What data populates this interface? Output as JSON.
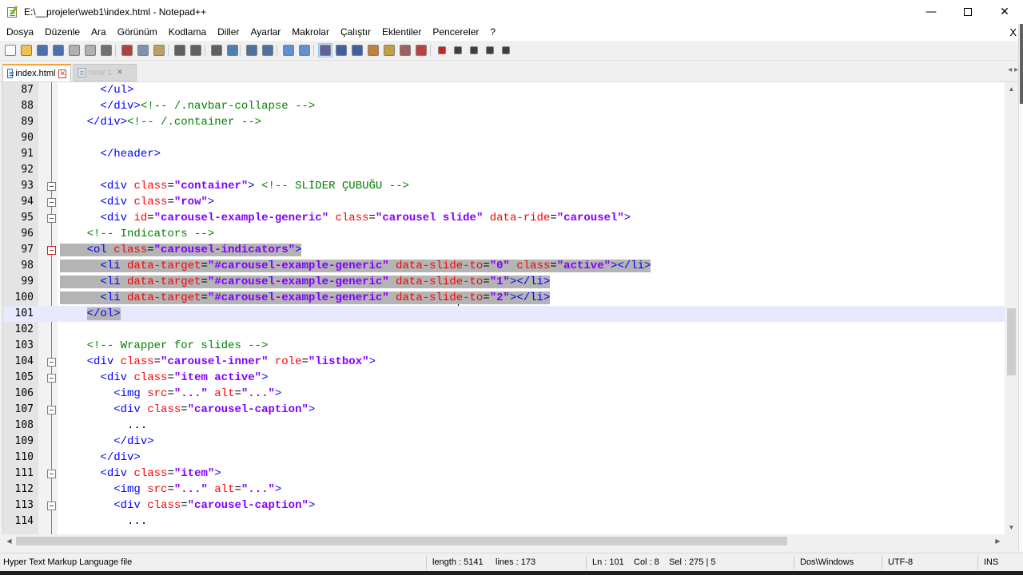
{
  "window": {
    "title": "E:\\__projeler\\web1\\index.html - Notepad++",
    "minimize": "—",
    "close": "✕"
  },
  "menu": {
    "items": [
      "Dosya",
      "Düzenle",
      "Ara",
      "Görünüm",
      "Kodlama",
      "Diller",
      "Ayarlar",
      "Makrolar",
      "Çalıştır",
      "Eklentiler",
      "Pencereler",
      "?"
    ],
    "close_doc": "X"
  },
  "tabs": [
    {
      "label": "index.html",
      "close": "✕"
    },
    {
      "label": "new 1",
      "close": "✕"
    }
  ],
  "tab_scroll": "◂ ▸",
  "editor": {
    "lines": [
      {
        "n": "87",
        "code": [
          [
            "      ",
            "pl"
          ],
          [
            "</ul>",
            "tag"
          ]
        ]
      },
      {
        "n": "88",
        "code": [
          [
            "      ",
            "pl"
          ],
          [
            "</div>",
            "tag"
          ],
          [
            "<!-- /.navbar-collapse -->",
            "cm"
          ]
        ]
      },
      {
        "n": "89",
        "code": [
          [
            "    ",
            "pl"
          ],
          [
            "</div>",
            "tag"
          ],
          [
            "<!-- /.container -->",
            "cm"
          ]
        ]
      },
      {
        "n": "90",
        "code": []
      },
      {
        "n": "91",
        "code": [
          [
            "      ",
            "pl"
          ],
          [
            "</header>",
            "tag"
          ]
        ]
      },
      {
        "n": "92",
        "code": []
      },
      {
        "n": "93",
        "code": [
          [
            "      ",
            "pl"
          ],
          [
            "<div ",
            "tag"
          ],
          [
            "class",
            "attr"
          ],
          [
            "=",
            "pl"
          ],
          [
            "\"container\"",
            "val"
          ],
          [
            "> ",
            "tag"
          ],
          [
            "<!-- SLİDER ÇUBUĞU -->",
            "cm"
          ]
        ]
      },
      {
        "n": "94",
        "code": [
          [
            "      ",
            "pl"
          ],
          [
            "<div ",
            "tag"
          ],
          [
            "class",
            "attr"
          ],
          [
            "=",
            "pl"
          ],
          [
            "\"row\"",
            "val"
          ],
          [
            ">",
            "tag"
          ]
        ]
      },
      {
        "n": "95",
        "code": [
          [
            "      ",
            "pl"
          ],
          [
            "<div ",
            "tag"
          ],
          [
            "id",
            "attr"
          ],
          [
            "=",
            "pl"
          ],
          [
            "\"carousel-example-generic\"",
            "val"
          ],
          [
            " ",
            "pl"
          ],
          [
            "class",
            "attr"
          ],
          [
            "=",
            "pl"
          ],
          [
            "\"carousel slide\"",
            "val"
          ],
          [
            " ",
            "pl"
          ],
          [
            "data-ride",
            "attr"
          ],
          [
            "=",
            "pl"
          ],
          [
            "\"carousel\"",
            "val"
          ],
          [
            ">",
            "tag"
          ]
        ]
      },
      {
        "n": "96",
        "code": [
          [
            "    ",
            "pl"
          ],
          [
            "<!-- Indicators -->",
            "cm"
          ]
        ]
      },
      {
        "n": "97",
        "code": [
          [
            "    ",
            "pl"
          ],
          [
            "<ol ",
            "tag"
          ],
          [
            "class",
            "attr"
          ],
          [
            "=",
            "pl"
          ],
          [
            "\"carousel-indicators\"",
            "val"
          ],
          [
            ">",
            "tag"
          ]
        ]
      },
      {
        "n": "98",
        "code": [
          [
            "      ",
            "pl"
          ],
          [
            "<li ",
            "tag"
          ],
          [
            "data-target",
            "attr"
          ],
          [
            "=",
            "pl"
          ],
          [
            "\"#carousel-example-generic\"",
            "val"
          ],
          [
            " ",
            "pl"
          ],
          [
            "data-slide-to",
            "attr"
          ],
          [
            "=",
            "pl"
          ],
          [
            "\"0\"",
            "val"
          ],
          [
            " ",
            "pl"
          ],
          [
            "class",
            "attr"
          ],
          [
            "=",
            "pl"
          ],
          [
            "\"active\"",
            "val"
          ],
          [
            "></li>",
            "tag"
          ]
        ]
      },
      {
        "n": "99",
        "code": [
          [
            "      ",
            "pl"
          ],
          [
            "<li ",
            "tag"
          ],
          [
            "data-target",
            "attr"
          ],
          [
            "=",
            "pl"
          ],
          [
            "\"#carousel-example-generic\"",
            "val"
          ],
          [
            " ",
            "pl"
          ],
          [
            "data-slide-to",
            "attr"
          ],
          [
            "=",
            "pl"
          ],
          [
            "\"1\"",
            "val"
          ],
          [
            "></li>",
            "tag"
          ]
        ]
      },
      {
        "n": "100",
        "code": [
          [
            "      ",
            "pl"
          ],
          [
            "<li ",
            "tag"
          ],
          [
            "data-target",
            "attr"
          ],
          [
            "=",
            "pl"
          ],
          [
            "\"#carousel-example-generic\"",
            "val"
          ],
          [
            " ",
            "pl"
          ],
          [
            "data-slide-to",
            "attr"
          ],
          [
            "=",
            "pl"
          ],
          [
            "\"2\"",
            "val"
          ],
          [
            "></li>",
            "tag"
          ]
        ]
      },
      {
        "n": "101",
        "code": [
          [
            "    ",
            "pl"
          ],
          [
            "</ol>",
            "tag"
          ]
        ]
      },
      {
        "n": "102",
        "code": []
      },
      {
        "n": "103",
        "code": [
          [
            "    ",
            "pl"
          ],
          [
            "<!-- Wrapper for slides -->",
            "cm"
          ]
        ]
      },
      {
        "n": "104",
        "code": [
          [
            "    ",
            "pl"
          ],
          [
            "<div ",
            "tag"
          ],
          [
            "class",
            "attr"
          ],
          [
            "=",
            "pl"
          ],
          [
            "\"carousel-inner\"",
            "val"
          ],
          [
            " ",
            "pl"
          ],
          [
            "role",
            "attr"
          ],
          [
            "=",
            "pl"
          ],
          [
            "\"listbox\"",
            "val"
          ],
          [
            ">",
            "tag"
          ]
        ]
      },
      {
        "n": "105",
        "code": [
          [
            "      ",
            "pl"
          ],
          [
            "<div ",
            "tag"
          ],
          [
            "class",
            "attr"
          ],
          [
            "=",
            "pl"
          ],
          [
            "\"item active\"",
            "val"
          ],
          [
            ">",
            "tag"
          ]
        ]
      },
      {
        "n": "106",
        "code": [
          [
            "        ",
            "pl"
          ],
          [
            "<img ",
            "tag"
          ],
          [
            "src",
            "attr"
          ],
          [
            "=",
            "pl"
          ],
          [
            "\"...\"",
            "val"
          ],
          [
            " ",
            "pl"
          ],
          [
            "alt",
            "attr"
          ],
          [
            "=",
            "pl"
          ],
          [
            "\"...\"",
            "val"
          ],
          [
            ">",
            "tag"
          ]
        ]
      },
      {
        "n": "107",
        "code": [
          [
            "        ",
            "pl"
          ],
          [
            "<div ",
            "tag"
          ],
          [
            "class",
            "attr"
          ],
          [
            "=",
            "pl"
          ],
          [
            "\"carousel-caption\"",
            "val"
          ],
          [
            ">",
            "tag"
          ]
        ]
      },
      {
        "n": "108",
        "code": [
          [
            "          ...",
            "pl"
          ]
        ]
      },
      {
        "n": "109",
        "code": [
          [
            "        ",
            "pl"
          ],
          [
            "</div>",
            "tag"
          ]
        ]
      },
      {
        "n": "110",
        "code": [
          [
            "      ",
            "pl"
          ],
          [
            "</div>",
            "tag"
          ]
        ]
      },
      {
        "n": "111",
        "code": [
          [
            "      ",
            "pl"
          ],
          [
            "<div ",
            "tag"
          ],
          [
            "class",
            "attr"
          ],
          [
            "=",
            "pl"
          ],
          [
            "\"item\"",
            "val"
          ],
          [
            ">",
            "tag"
          ]
        ]
      },
      {
        "n": "112",
        "code": [
          [
            "        ",
            "pl"
          ],
          [
            "<img ",
            "tag"
          ],
          [
            "src",
            "attr"
          ],
          [
            "=",
            "pl"
          ],
          [
            "\"...\"",
            "val"
          ],
          [
            " ",
            "pl"
          ],
          [
            "alt",
            "attr"
          ],
          [
            "=",
            "pl"
          ],
          [
            "\"...\"",
            "val"
          ],
          [
            ">",
            "tag"
          ]
        ]
      },
      {
        "n": "113",
        "code": [
          [
            "        ",
            "pl"
          ],
          [
            "<div ",
            "tag"
          ],
          [
            "class",
            "attr"
          ],
          [
            "=",
            "pl"
          ],
          [
            "\"carousel-caption\"",
            "val"
          ],
          [
            ">",
            "tag"
          ]
        ]
      },
      {
        "n": "114",
        "code": [
          [
            "          ...",
            "pl"
          ]
        ]
      }
    ],
    "selected_lines": [
      "97",
      "98",
      "99",
      "100",
      "101"
    ],
    "current_line": "101"
  },
  "scroll": {
    "up": "▲",
    "down": "▼",
    "left": "◀",
    "right": "▶"
  },
  "status": {
    "file_type": "Hyper Text Markup Language file",
    "length": "length : 5141",
    "lines": "lines : 173",
    "ln": "Ln : 101",
    "col": "Col : 8",
    "sel": "Sel : 275 | 5",
    "eol": "Dos\\Windows",
    "encoding": "UTF-8",
    "mode": "INS"
  },
  "colors": {
    "tag": "#0000ff",
    "attr": "#ff0000",
    "value": "#8000ff",
    "comment": "#008000",
    "selection": "#b4b4b4",
    "current_line": "#e8e8ff",
    "active_tab_accent": "#f9a03f"
  },
  "toolbar_icons": [
    "new-file-icon",
    "open-file-icon",
    "save-icon",
    "save-all-icon",
    "close-icon",
    "close-all-icon",
    "print-icon",
    "cut-icon",
    "copy-icon",
    "paste-icon",
    "undo-icon",
    "redo-icon",
    "find-icon",
    "replace-icon",
    "zoom-in-icon",
    "zoom-out-icon",
    "sync-vertical-icon",
    "sync-horizontal-icon",
    "word-wrap-icon",
    "show-all-chars-icon",
    "indent-guide-icon",
    "user-lang-icon",
    "doc-map-icon",
    "function-list-icon",
    "folder-workspace-icon",
    "record-macro-icon",
    "stop-macro-icon",
    "play-macro-icon",
    "run-macro-multiple-icon",
    "save-macro-icon"
  ]
}
